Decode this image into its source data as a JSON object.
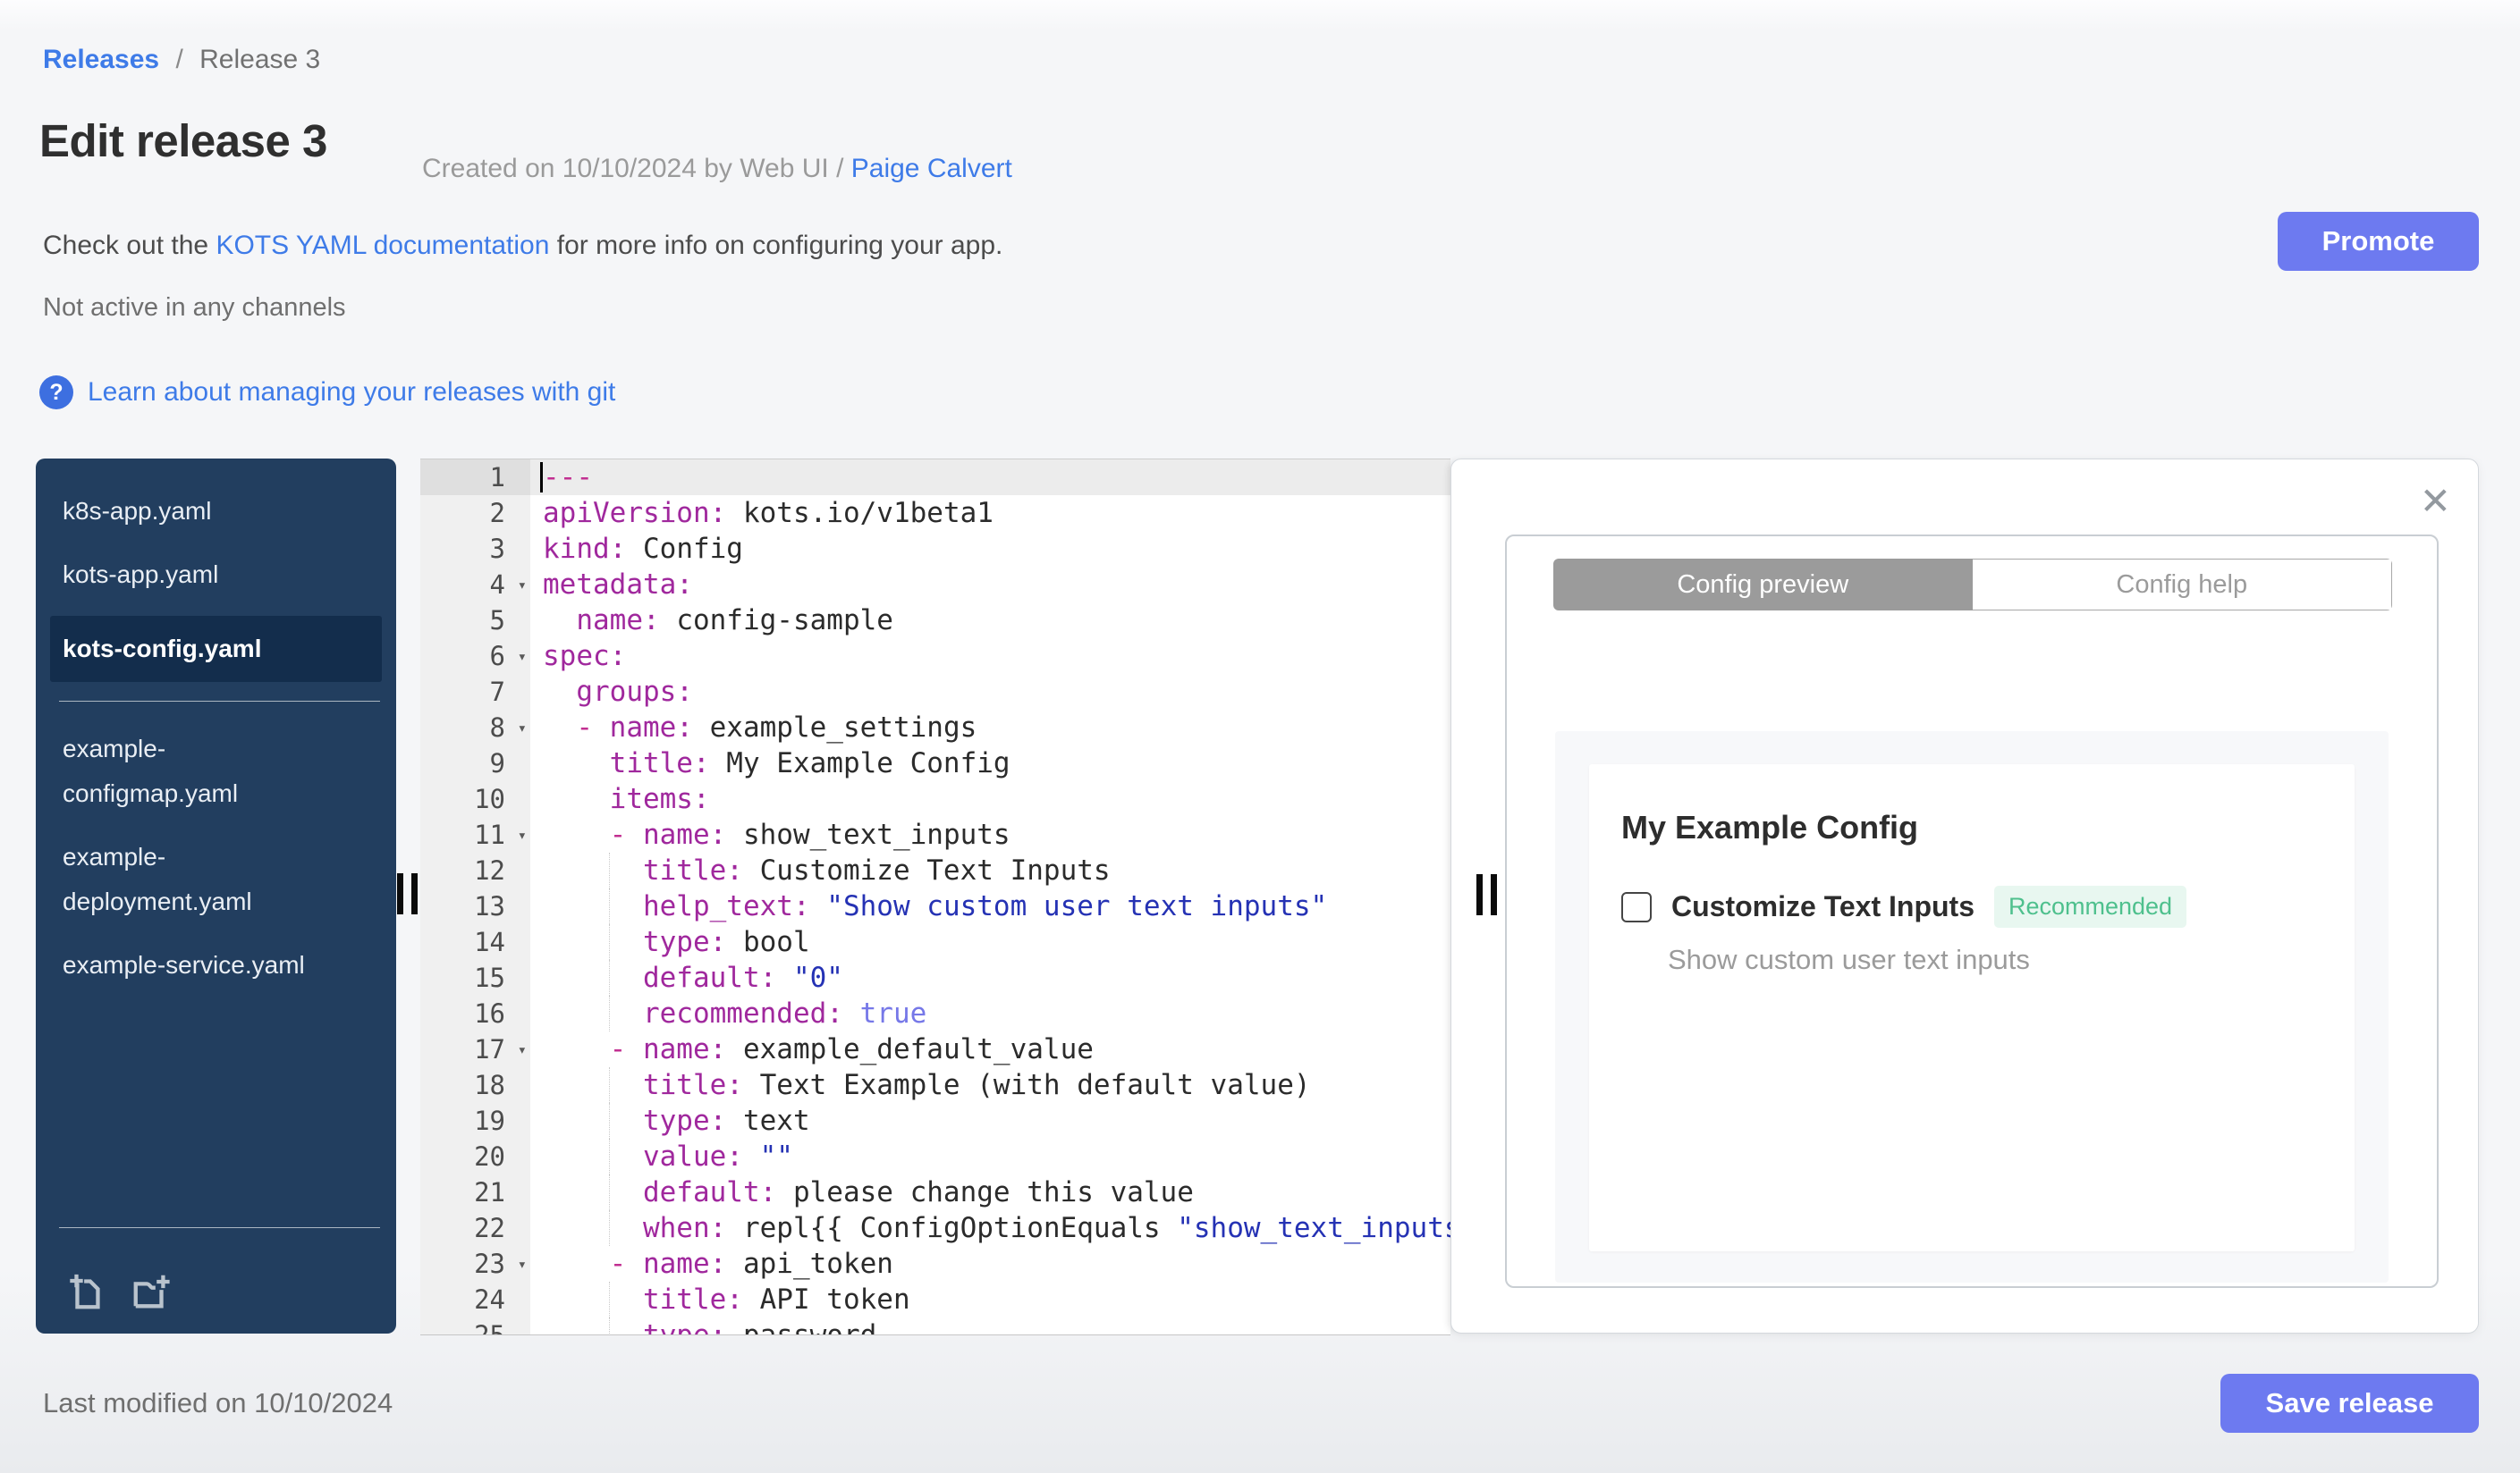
{
  "breadcrumb": {
    "link": "Releases",
    "separator": "/",
    "current": "Release 3"
  },
  "header": {
    "title": "Edit release 3",
    "created_prefix": "Created on 10/10/2024 by Web UI / ",
    "created_author": "Paige Calvert",
    "doc_prefix": "Check out the ",
    "doc_link": "KOTS YAML documentation",
    "doc_suffix": " for more info on configuring your app.",
    "status": "Not active in any channels",
    "help_icon": "?",
    "git_link": "Learn about managing your releases with git",
    "promote_label": "Promote"
  },
  "sidebar": {
    "files": [
      {
        "name": "k8s-app.yaml",
        "selected": false
      },
      {
        "name": "kots-app.yaml",
        "selected": false
      },
      {
        "name": "kots-config.yaml",
        "selected": true
      },
      {
        "name": "example-configmap.yaml",
        "selected": false
      },
      {
        "name": "example-deployment.yaml",
        "selected": false
      },
      {
        "name": "example-service.yaml",
        "selected": false
      }
    ],
    "divider_after_index": 2,
    "icons": [
      "file-plus-icon",
      "folder-plus-icon"
    ]
  },
  "editor": {
    "filename": "kots-config.yaml",
    "lines": [
      {
        "n": 1,
        "active": true,
        "fold": false,
        "g": false,
        "tokens": [
          [
            "dash",
            "---"
          ]
        ]
      },
      {
        "n": 2,
        "active": false,
        "fold": false,
        "g": false,
        "tokens": [
          [
            "key",
            "apiVersion:"
          ],
          [
            "val",
            " kots.io/v1beta1"
          ]
        ]
      },
      {
        "n": 3,
        "active": false,
        "fold": false,
        "g": false,
        "tokens": [
          [
            "key",
            "kind:"
          ],
          [
            "val",
            " Config"
          ]
        ]
      },
      {
        "n": 4,
        "active": false,
        "fold": true,
        "g": false,
        "tokens": [
          [
            "key",
            "metadata:"
          ]
        ]
      },
      {
        "n": 5,
        "active": false,
        "fold": false,
        "g": false,
        "tokens": [
          [
            "val",
            "  "
          ],
          [
            "key",
            "name:"
          ],
          [
            "val",
            " config-sample"
          ]
        ]
      },
      {
        "n": 6,
        "active": false,
        "fold": true,
        "g": false,
        "tokens": [
          [
            "key",
            "spec:"
          ]
        ]
      },
      {
        "n": 7,
        "active": false,
        "fold": false,
        "g": false,
        "tokens": [
          [
            "val",
            "  "
          ],
          [
            "key",
            "groups:"
          ]
        ]
      },
      {
        "n": 8,
        "active": false,
        "fold": true,
        "g": false,
        "tokens": [
          [
            "val",
            "  "
          ],
          [
            "dash",
            "- "
          ],
          [
            "key",
            "name:"
          ],
          [
            "val",
            " example_settings"
          ]
        ]
      },
      {
        "n": 9,
        "active": false,
        "fold": false,
        "g": false,
        "tokens": [
          [
            "val",
            "    "
          ],
          [
            "key",
            "title:"
          ],
          [
            "val",
            " My Example Config"
          ]
        ]
      },
      {
        "n": 10,
        "active": false,
        "fold": false,
        "g": false,
        "tokens": [
          [
            "val",
            "    "
          ],
          [
            "key",
            "items:"
          ]
        ]
      },
      {
        "n": 11,
        "active": false,
        "fold": true,
        "g": false,
        "tokens": [
          [
            "val",
            "    "
          ],
          [
            "dash",
            "- "
          ],
          [
            "key",
            "name:"
          ],
          [
            "val",
            " show_text_inputs"
          ]
        ]
      },
      {
        "n": 12,
        "active": false,
        "fold": false,
        "g": true,
        "tokens": [
          [
            "val",
            "      "
          ],
          [
            "key",
            "title:"
          ],
          [
            "val",
            " Customize Text Inputs"
          ]
        ]
      },
      {
        "n": 13,
        "active": false,
        "fold": false,
        "g": true,
        "tokens": [
          [
            "val",
            "      "
          ],
          [
            "key",
            "help_text:"
          ],
          [
            "val",
            " "
          ],
          [
            "str",
            "\"Show custom user text inputs\""
          ]
        ]
      },
      {
        "n": 14,
        "active": false,
        "fold": false,
        "g": true,
        "tokens": [
          [
            "val",
            "      "
          ],
          [
            "key",
            "type:"
          ],
          [
            "val",
            " bool"
          ]
        ]
      },
      {
        "n": 15,
        "active": false,
        "fold": false,
        "g": true,
        "tokens": [
          [
            "val",
            "      "
          ],
          [
            "key",
            "default:"
          ],
          [
            "val",
            " "
          ],
          [
            "str",
            "\"0\""
          ]
        ]
      },
      {
        "n": 16,
        "active": false,
        "fold": false,
        "g": true,
        "tokens": [
          [
            "val",
            "      "
          ],
          [
            "key",
            "recommended:"
          ],
          [
            "val",
            " "
          ],
          [
            "bool",
            "true"
          ]
        ]
      },
      {
        "n": 17,
        "active": false,
        "fold": true,
        "g": false,
        "tokens": [
          [
            "val",
            "    "
          ],
          [
            "dash",
            "- "
          ],
          [
            "key",
            "name:"
          ],
          [
            "val",
            " example_default_value"
          ]
        ]
      },
      {
        "n": 18,
        "active": false,
        "fold": false,
        "g": true,
        "tokens": [
          [
            "val",
            "      "
          ],
          [
            "key",
            "title:"
          ],
          [
            "val",
            " Text Example (with default value)"
          ]
        ]
      },
      {
        "n": 19,
        "active": false,
        "fold": false,
        "g": true,
        "tokens": [
          [
            "val",
            "      "
          ],
          [
            "key",
            "type:"
          ],
          [
            "val",
            " text"
          ]
        ]
      },
      {
        "n": 20,
        "active": false,
        "fold": false,
        "g": true,
        "tokens": [
          [
            "val",
            "      "
          ],
          [
            "key",
            "value:"
          ],
          [
            "val",
            " "
          ],
          [
            "str",
            "\"\""
          ]
        ]
      },
      {
        "n": 21,
        "active": false,
        "fold": false,
        "g": true,
        "tokens": [
          [
            "val",
            "      "
          ],
          [
            "key",
            "default:"
          ],
          [
            "val",
            " please change this value"
          ]
        ]
      },
      {
        "n": 22,
        "active": false,
        "fold": false,
        "g": true,
        "tokens": [
          [
            "val",
            "      "
          ],
          [
            "key",
            "when:"
          ],
          [
            "val",
            " repl{{ ConfigOptionEquals "
          ],
          [
            "str",
            "\"show_text_inputs\""
          ]
        ]
      },
      {
        "n": 23,
        "active": false,
        "fold": true,
        "g": false,
        "tokens": [
          [
            "val",
            "    "
          ],
          [
            "dash",
            "- "
          ],
          [
            "key",
            "name:"
          ],
          [
            "val",
            " api_token"
          ]
        ]
      },
      {
        "n": 24,
        "active": false,
        "fold": false,
        "g": true,
        "tokens": [
          [
            "val",
            "      "
          ],
          [
            "key",
            "title:"
          ],
          [
            "val",
            " API token"
          ]
        ]
      },
      {
        "n": 25,
        "active": false,
        "fold": false,
        "g": true,
        "tokens": [
          [
            "val",
            "      "
          ],
          [
            "key",
            "type:"
          ],
          [
            "val",
            " password"
          ]
        ]
      }
    ]
  },
  "panel": {
    "close_icon": "✕",
    "tabs": [
      {
        "label": "Config preview",
        "active": true
      },
      {
        "label": "Config help",
        "active": false
      }
    ],
    "group_title": "My Example Config",
    "item": {
      "label": "Customize Text Inputs",
      "badge": "Recommended",
      "help_text": "Show custom user text inputs",
      "checked": false
    }
  },
  "footer": {
    "last_modified": "Last modified on 10/10/2024",
    "save_label": "Save release"
  },
  "colors": {
    "accent_button": "#6d7af0",
    "link_blue": "#3e7be8",
    "sidebar_navy": "#223e5f",
    "sidebar_selected": "#132d4c",
    "badge_green_text": "#4ec08d",
    "badge_green_bg": "#e8f7f0",
    "yaml_key": "#a0289d",
    "yaml_string": "#2532b4",
    "yaml_bool": "#7678e8",
    "tab_active_bg": "#9b9b9b"
  }
}
